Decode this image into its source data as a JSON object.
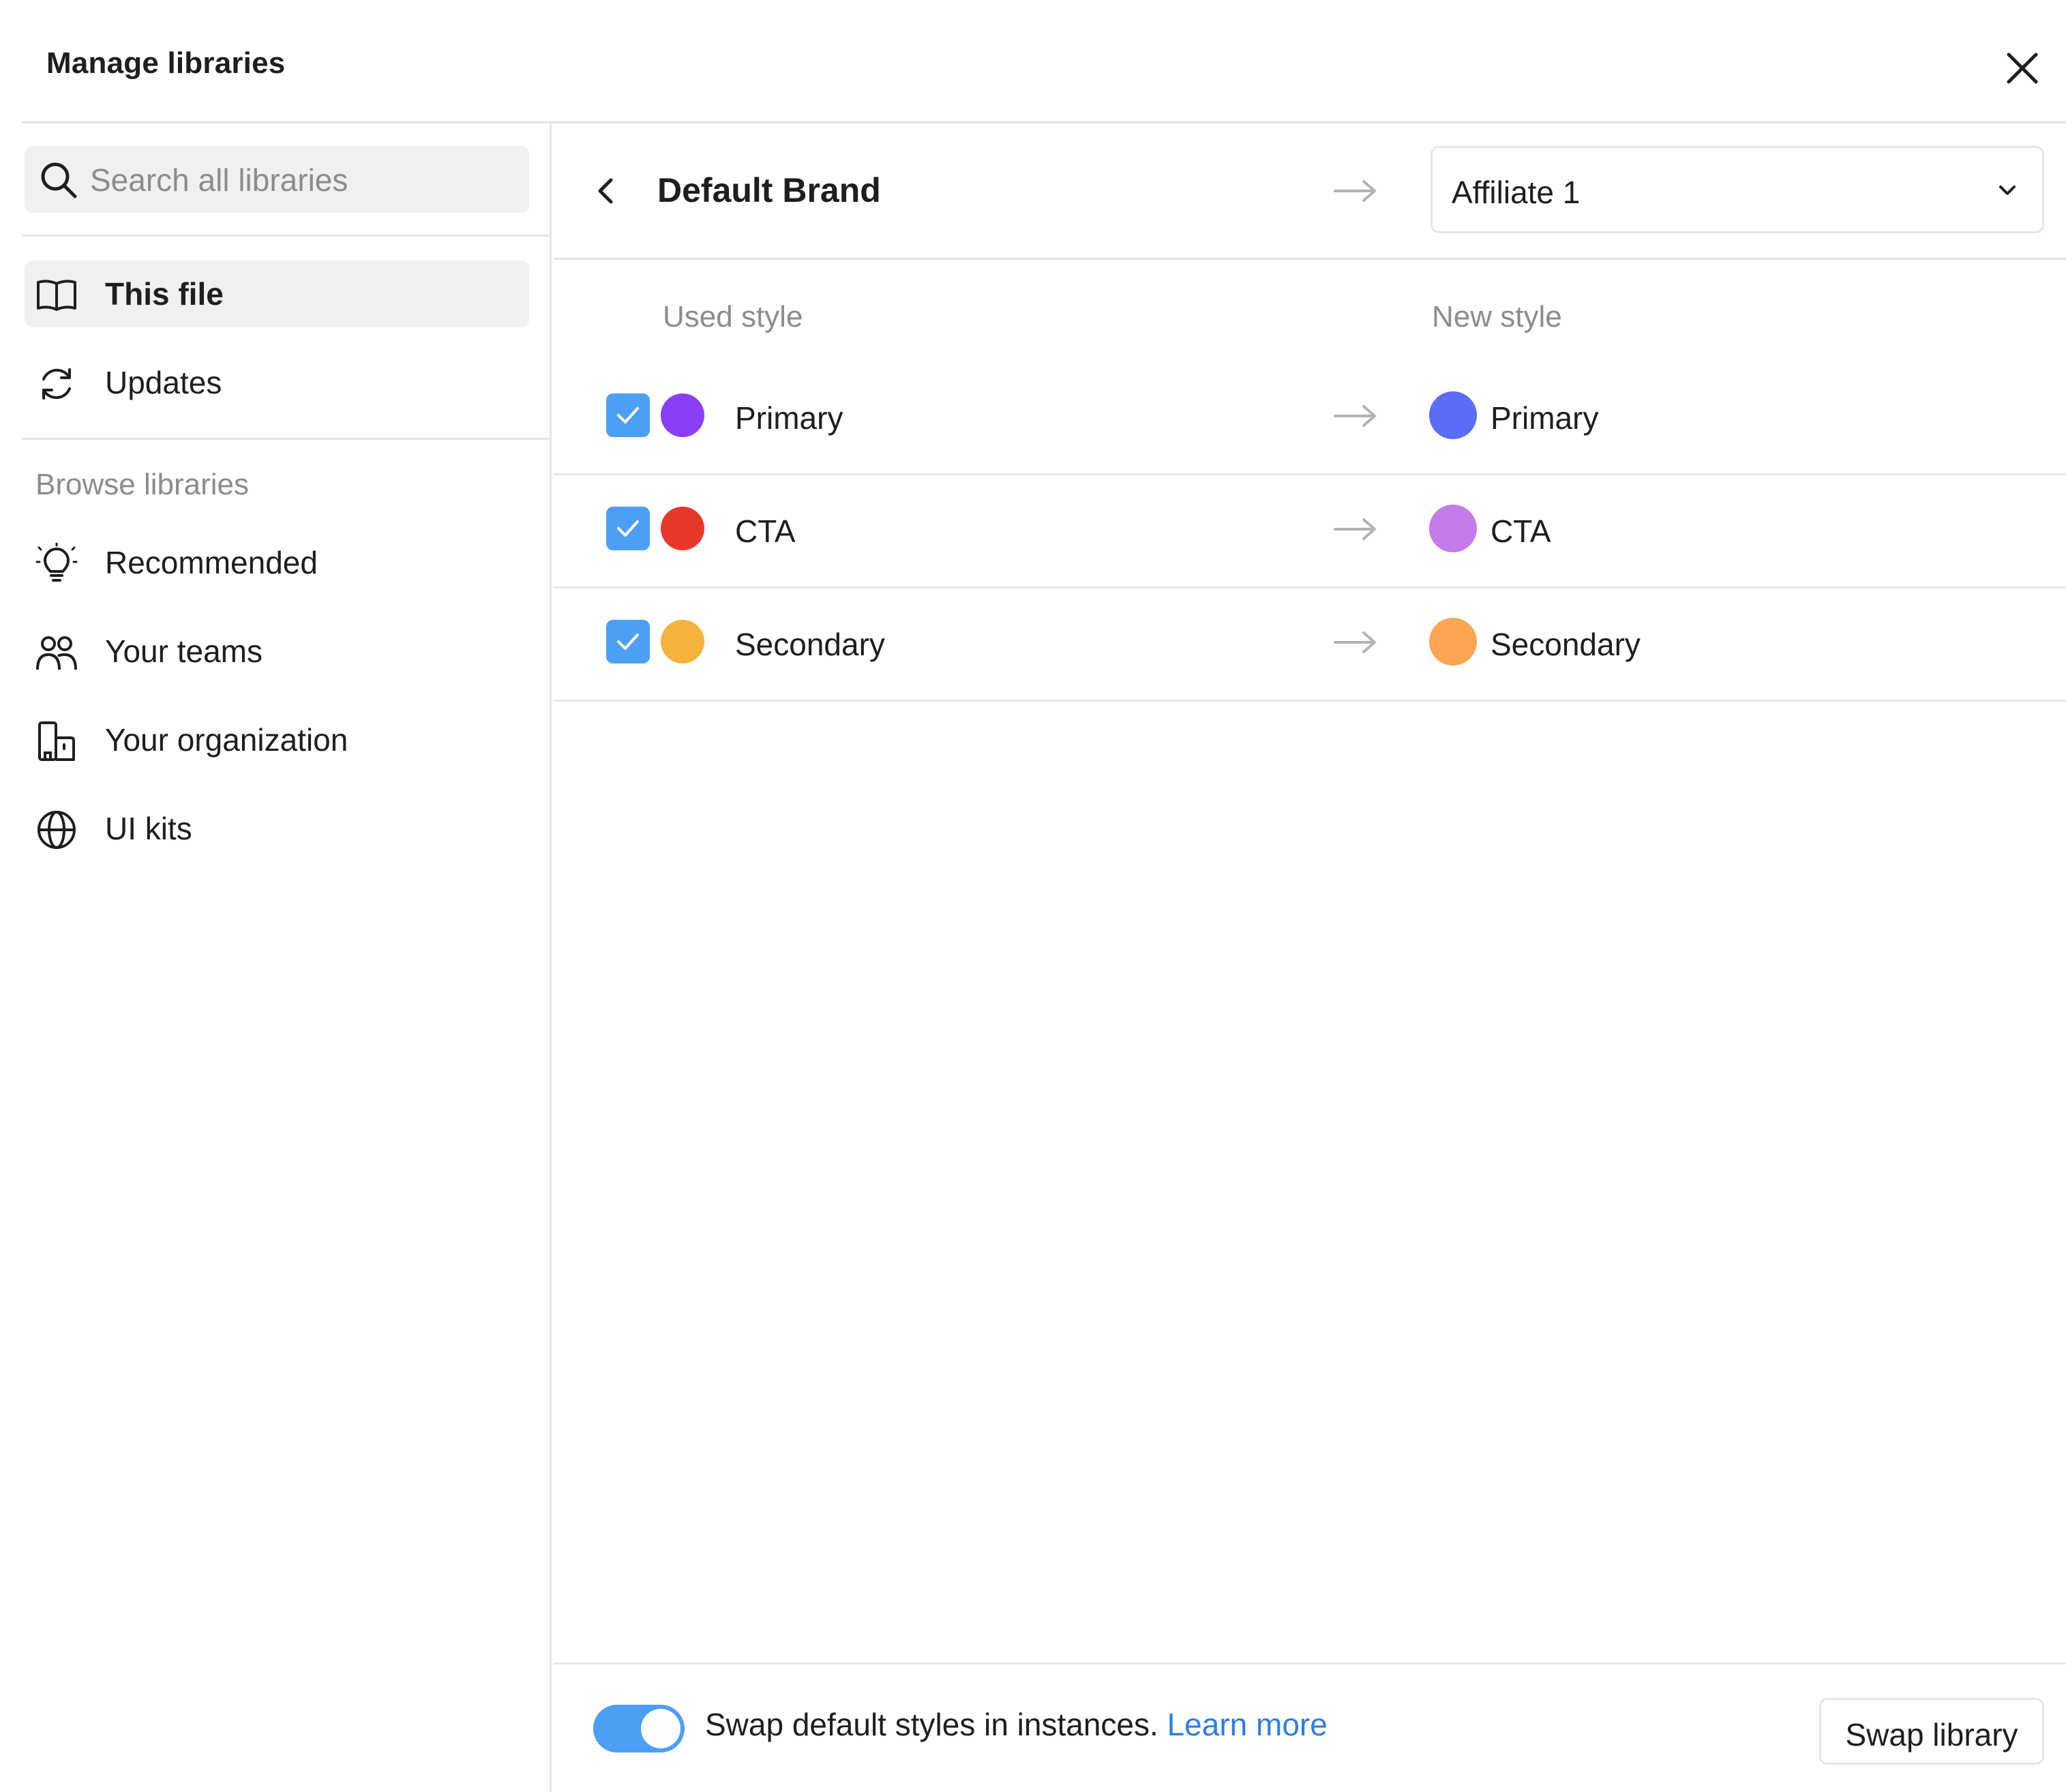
{
  "dialog": {
    "title": "Manage libraries"
  },
  "search": {
    "placeholder": "Search all libraries",
    "icon": "search-icon"
  },
  "sidebar": {
    "items": [
      {
        "label": "This file",
        "icon": "book-icon",
        "active": true
      },
      {
        "label": "Updates",
        "icon": "refresh-icon",
        "active": false
      }
    ],
    "browse_label": "Browse libraries",
    "browse_items": [
      {
        "label": "Recommended",
        "icon": "lightbulb-icon"
      },
      {
        "label": "Your teams",
        "icon": "people-icon"
      },
      {
        "label": "Your organization",
        "icon": "organization-icon"
      },
      {
        "label": "UI kits",
        "icon": "globe-icon"
      }
    ]
  },
  "swap": {
    "from_library": "Default Brand",
    "to_library": "Affiliate 1",
    "used_style_header": "Used style",
    "new_style_header": "New style",
    "rows": [
      {
        "checked": true,
        "used_name": "Primary",
        "used_color": "#8b3ff5",
        "new_name": "Primary",
        "new_color": "#5b6cf6"
      },
      {
        "checked": true,
        "used_name": "CTA",
        "used_color": "#e8372a",
        "new_name": "CTA",
        "new_color": "#c47ce8"
      },
      {
        "checked": true,
        "used_name": "Secondary",
        "used_color": "#f3b33d",
        "new_name": "Secondary",
        "new_color": "#fca552"
      }
    ]
  },
  "footer": {
    "toggle_on": true,
    "text": "Swap default styles in instances.",
    "link": "Learn more",
    "button": "Swap library"
  },
  "colors": {
    "accent": "#4d9ff5",
    "link": "#2f7de1",
    "muted": "#8c8c8c",
    "divider": "#e6e6e6"
  }
}
